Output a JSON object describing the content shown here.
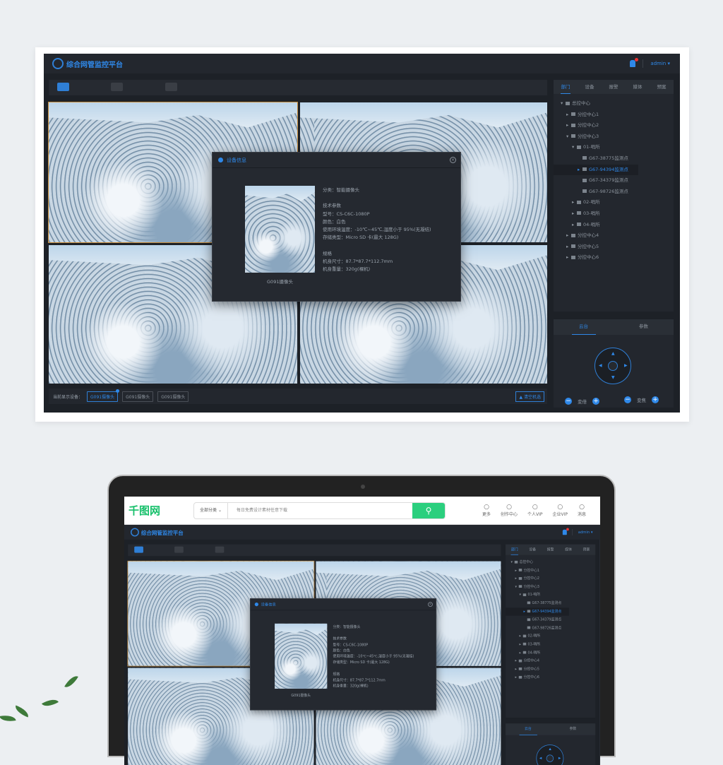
{
  "app": {
    "title": "综合网管监控平台",
    "user": "admin"
  },
  "layouts": [
    "single",
    "quad",
    "nine"
  ],
  "bottom_bar": {
    "label": "当前显示设备：",
    "chips": [
      "G091摄像头",
      "G091摄像头",
      "G091摄像头"
    ],
    "clear": "清空机选"
  },
  "sidebar": {
    "tabs": [
      "部门",
      "设备",
      "报警",
      "媒体",
      "预案"
    ],
    "tree": [
      {
        "label": "总控中心",
        "lvl": 0,
        "arrow": "▾"
      },
      {
        "label": "分控中心1",
        "lvl": 1,
        "arrow": "▸"
      },
      {
        "label": "分控中心2",
        "lvl": 1,
        "arrow": "▸"
      },
      {
        "label": "分控中心3",
        "lvl": 1,
        "arrow": "▾"
      },
      {
        "label": "01-哨所",
        "lvl": 2,
        "arrow": "▾"
      },
      {
        "label": "G67-38775监测点",
        "lvl": 3,
        "arrow": ""
      },
      {
        "label": "G67-94394监测点",
        "lvl": 3,
        "arrow": "▸",
        "selected": true
      },
      {
        "label": "G67-34379监测点",
        "lvl": 3,
        "arrow": ""
      },
      {
        "label": "G67-98726监测点",
        "lvl": 3,
        "arrow": ""
      },
      {
        "label": "02-哨所",
        "lvl": 2,
        "arrow": "▸"
      },
      {
        "label": "03-哨所",
        "lvl": 2,
        "arrow": "▸"
      },
      {
        "label": "04-哨所",
        "lvl": 2,
        "arrow": "▸"
      },
      {
        "label": "分控中心4",
        "lvl": 1,
        "arrow": "▸"
      },
      {
        "label": "分控中心5",
        "lvl": 1,
        "arrow": "▸"
      },
      {
        "label": "分控中心6",
        "lvl": 1,
        "arrow": "▸"
      }
    ]
  },
  "ptz": {
    "tabs": [
      "云台",
      "参数"
    ],
    "zoom": "变倍",
    "focus": "变焦"
  },
  "dialog": {
    "title": "设备信息",
    "caption": "G091摄像头",
    "lines": [
      "分类：智能摄像头",
      "",
      "技术参数",
      "型号：CS-C6C-1080P",
      "颜色：白色",
      "使用环境温度：-10℃~45℃,湿度小于 95%(无凝结)",
      "存储类型：Micro SD 卡(最大 128G)",
      "",
      "规格",
      "机身尺寸：87.7*87.7*112.7mm",
      "机身重量：320g(裸机)"
    ]
  },
  "site": {
    "brand": "千图网",
    "category": "全部分类",
    "search_placeholder": "每日免费设计素材任意下载",
    "links": [
      "更多",
      "创作中心",
      "个人VIP",
      "企业VIP",
      "消息"
    ]
  },
  "colors": {
    "accent": "#2f88e8",
    "bg": "#1d2127",
    "site_green": "#2bcf7e"
  }
}
